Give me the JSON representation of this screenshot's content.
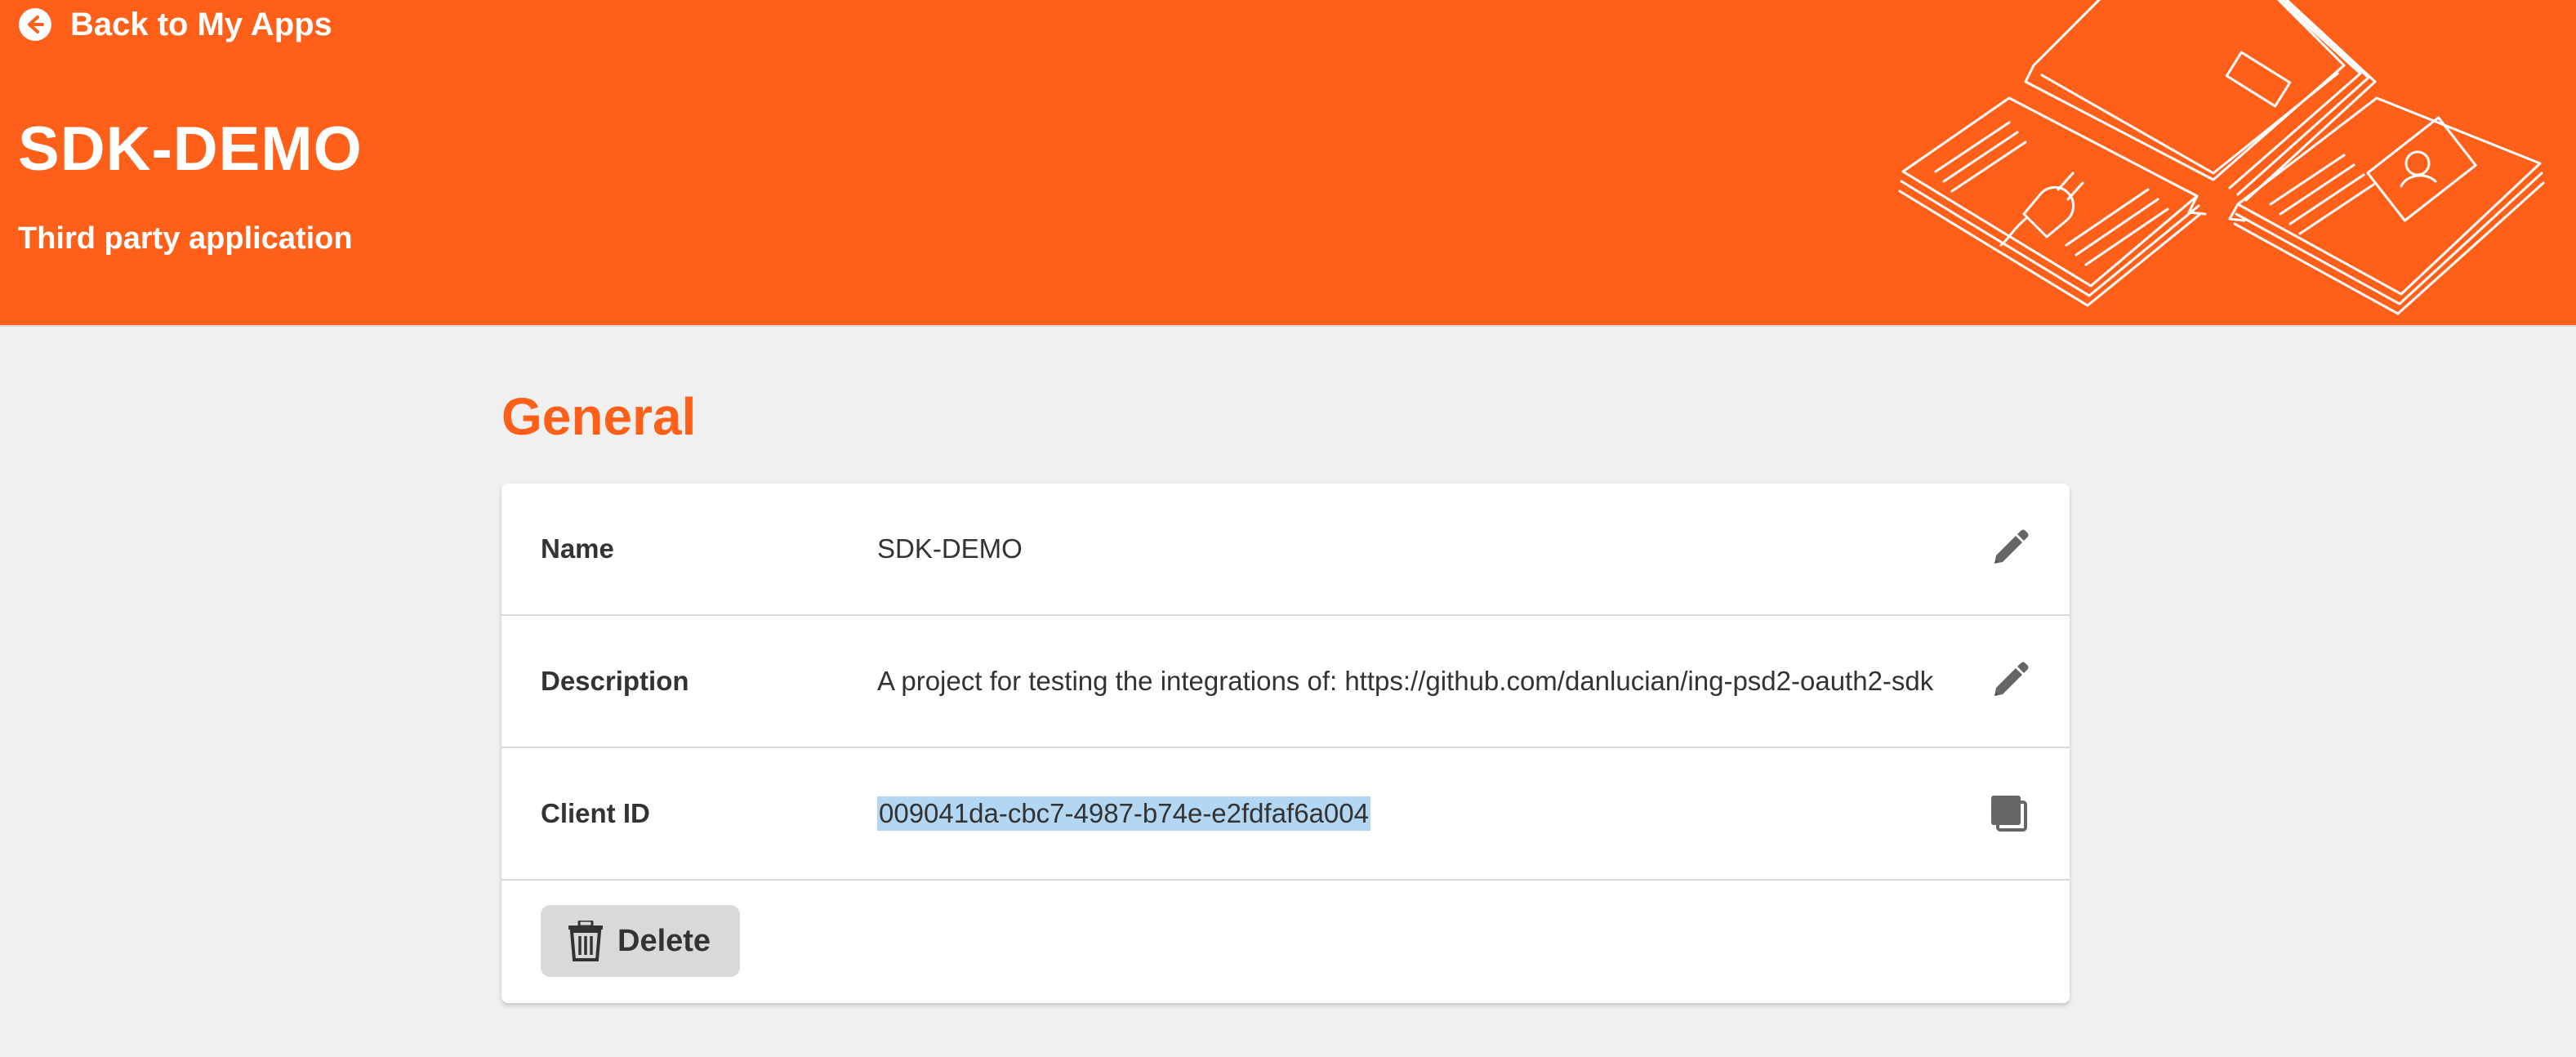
{
  "header": {
    "back_label": "Back to My Apps",
    "back_icon": "arrow-left-circle-icon",
    "title": "SDK-DEMO",
    "subtitle": "Third party application",
    "illustration_icon": "documents-illustration",
    "background_color": "#ff6019"
  },
  "section": {
    "title": "General",
    "title_color": "#ff6019"
  },
  "rows": [
    {
      "label": "Name",
      "value": "SDK-DEMO",
      "action_icon": "pencil-icon"
    },
    {
      "label": "Description",
      "value": "A project for testing the integrations of: https://github.com/danlucian/ing-psd2-oauth2-sdk",
      "action_icon": "pencil-icon"
    },
    {
      "label": "Client ID",
      "value": "009041da-cbc7-4987-b74e-e2fdfaf6a004",
      "action_icon": "copy-icon",
      "selected": true,
      "selection_color": "#b3d7f3"
    }
  ],
  "delete_button": {
    "label": "Delete",
    "icon": "trash-icon"
  }
}
